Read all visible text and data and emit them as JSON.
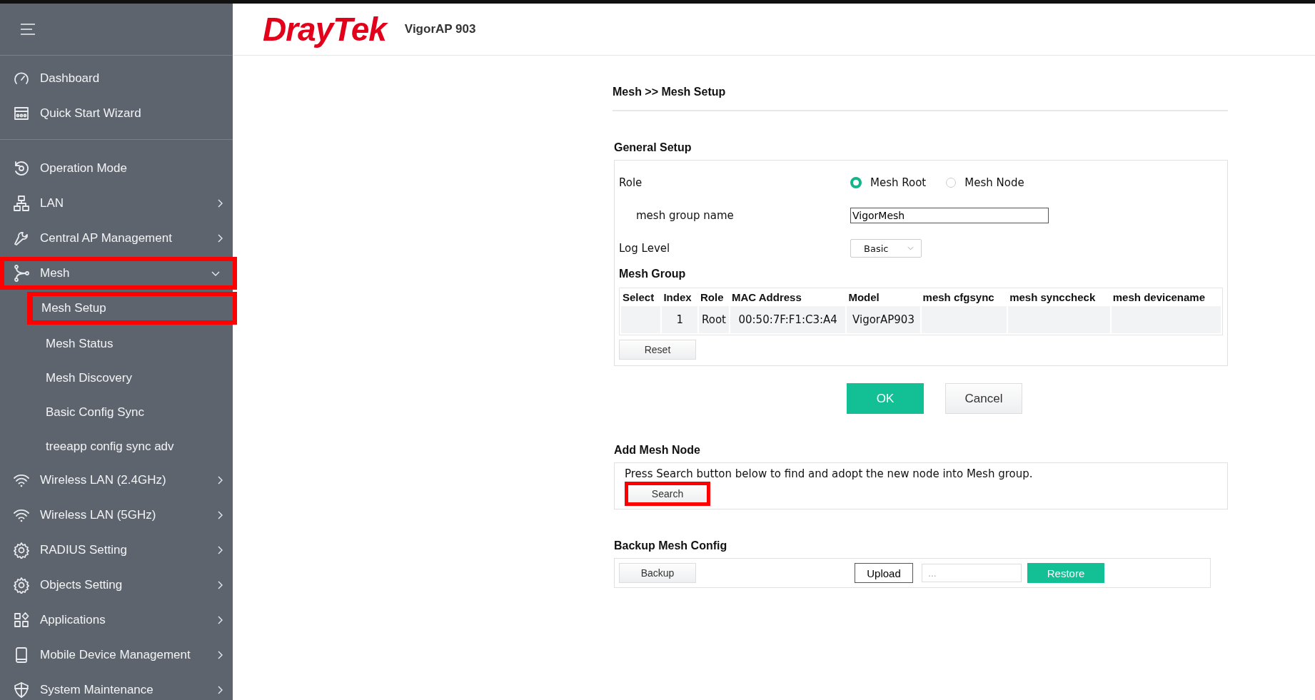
{
  "header": {
    "logo": "DrayTek",
    "model": "VigorAP 903"
  },
  "sidebar": {
    "sections": [
      {
        "items": [
          {
            "label": "Dashboard",
            "kind": "link",
            "highlighted": false
          },
          {
            "label": "Quick Start Wizard",
            "kind": "link",
            "highlighted": false
          }
        ]
      },
      {
        "items": [
          {
            "label": "Operation Mode",
            "kind": "link",
            "highlighted": false
          },
          {
            "label": "LAN",
            "kind": "menu",
            "expanded": false,
            "highlighted": false
          },
          {
            "label": "Central AP Management",
            "kind": "menu",
            "expanded": false,
            "highlighted": false
          },
          {
            "label": "Mesh",
            "kind": "menu",
            "expanded": true,
            "highlighted": true,
            "children": [
              {
                "label": "Mesh Setup",
                "highlighted": true
              },
              {
                "label": "Mesh Status",
                "highlighted": false
              },
              {
                "label": "Mesh Discovery",
                "highlighted": false
              },
              {
                "label": "Basic Config Sync",
                "highlighted": false
              },
              {
                "label": "treeapp config sync adv",
                "highlighted": false
              }
            ]
          },
          {
            "label": "Wireless LAN (2.4GHz)",
            "kind": "menu",
            "expanded": false,
            "highlighted": false
          },
          {
            "label": "Wireless LAN (5GHz)",
            "kind": "menu",
            "expanded": false,
            "highlighted": false
          },
          {
            "label": "RADIUS Setting",
            "kind": "menu",
            "expanded": false,
            "highlighted": false
          },
          {
            "label": "Objects Setting",
            "kind": "menu",
            "expanded": false,
            "highlighted": false
          },
          {
            "label": "Applications",
            "kind": "menu",
            "expanded": false,
            "highlighted": false
          },
          {
            "label": "Mobile Device Management",
            "kind": "menu",
            "expanded": false,
            "highlighted": false
          },
          {
            "label": "System Maintenance",
            "kind": "menu",
            "expanded": false,
            "highlighted": false
          }
        ]
      }
    ]
  },
  "breadcrumb": "Mesh >> Mesh Setup",
  "general_setup": {
    "title": "General Setup",
    "role": {
      "label": "Role",
      "options": [
        {
          "label": "Mesh Root",
          "selected": true
        },
        {
          "label": "Mesh Node",
          "selected": false
        }
      ]
    },
    "group_name": {
      "label": "mesh group name",
      "value": "VigorMesh"
    },
    "log_level": {
      "label": "Log Level",
      "value": "Basic"
    },
    "mesh_group": {
      "title": "Mesh Group",
      "columns": [
        "Select",
        "Index",
        "Role",
        "MAC Address",
        "Model",
        "mesh cfgsync",
        "mesh synccheck",
        "mesh devicename"
      ],
      "rows": [
        {
          "cells": [
            null,
            "1",
            "Root",
            "00:50:7F:F1:C3:A4",
            "VigorAP903",
            null,
            null,
            null
          ]
        }
      ],
      "reset_button": "Reset"
    }
  },
  "actions": {
    "ok": "OK",
    "cancel": "Cancel"
  },
  "add_mesh_node": {
    "title": "Add Mesh Node",
    "text": "Press Search button below to find and adopt the new node into Mesh group.",
    "search_button": {
      "label": "Search",
      "highlighted": true
    }
  },
  "backup": {
    "title": "Backup Mesh Config",
    "backup_button": "Backup",
    "upload_button": "Upload",
    "file_field": {
      "placeholder": "..."
    },
    "restore_button": "Restore"
  }
}
